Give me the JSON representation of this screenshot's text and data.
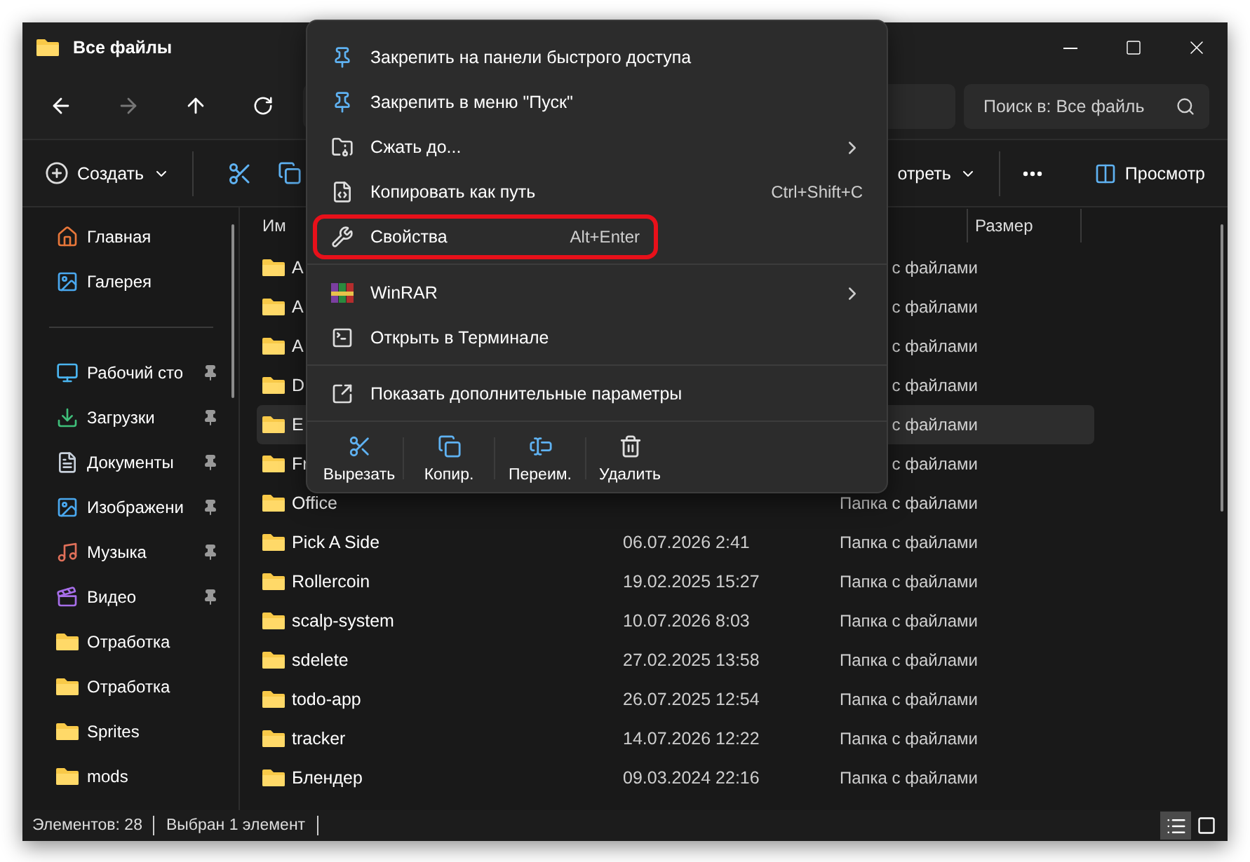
{
  "window": {
    "title": "Все файлы"
  },
  "nav": {
    "search_placeholder": "Поиск в: Все файль"
  },
  "command_bar": {
    "new_label": "Создать",
    "view_label": "отреть",
    "preview_label": "Просмотр"
  },
  "sidebar": {
    "groups": [
      [
        {
          "label": "Главная",
          "pinned": false
        },
        {
          "label": "Галерея",
          "pinned": false
        }
      ],
      [
        {
          "label": "Рабочий сто",
          "pinned": true
        },
        {
          "label": "Загрузки",
          "pinned": true
        },
        {
          "label": "Документы",
          "pinned": true
        },
        {
          "label": "Изображени",
          "pinned": true
        },
        {
          "label": "Музыка",
          "pinned": true
        },
        {
          "label": "Видео",
          "pinned": true
        },
        {
          "label": "Отработка",
          "pinned": false
        },
        {
          "label": "Отработка",
          "pinned": false
        },
        {
          "label": "Sprites",
          "pinned": false
        },
        {
          "label": "mods",
          "pinned": false
        }
      ]
    ]
  },
  "list": {
    "columns": [
      "Им",
      "Размер"
    ],
    "rows": [
      {
        "name": "A",
        "type": "с файлами",
        "selected": false
      },
      {
        "name": "A",
        "type": "с файлами",
        "selected": false
      },
      {
        "name": "A",
        "type": "с файлами",
        "selected": false
      },
      {
        "name": "D",
        "type": "с файлами",
        "selected": false
      },
      {
        "name": "E",
        "type": "с файлами",
        "selected": true
      },
      {
        "name": "Fr",
        "type": "с файлами",
        "selected": false
      },
      {
        "name": "Office",
        "type": "Папка с файлами",
        "selected": false
      },
      {
        "name": "Pick A Side",
        "date": "06.07.2026 2:41",
        "type": "Папка с файлами",
        "selected": false
      },
      {
        "name": "Rollercoin",
        "date": "19.02.2025 15:27",
        "type": "Папка с файлами",
        "selected": false
      },
      {
        "name": "scalp-system",
        "date": "10.07.2026 8:03",
        "type": "Папка с файлами",
        "selected": false
      },
      {
        "name": "sdelete",
        "date": "27.02.2025 13:58",
        "type": "Папка с файлами",
        "selected": false
      },
      {
        "name": "todo-app",
        "date": "26.07.2025 12:54",
        "type": "Папка с файлами",
        "selected": false
      },
      {
        "name": "tracker",
        "date": "14.07.2026 12:22",
        "type": "Папка с файлами",
        "selected": false
      },
      {
        "name": "Блендер",
        "date": "09.03.2024 22:16",
        "type": "Папка с файлами",
        "selected": false
      }
    ]
  },
  "context_menu": {
    "items": [
      {
        "kind": "item",
        "label": "Закрепить на панели быстрого доступа",
        "submenu": false,
        "highlighted": false
      },
      {
        "kind": "item",
        "label": "Закрепить в меню \"Пуск\"",
        "submenu": false,
        "highlighted": false
      },
      {
        "kind": "item",
        "label": "Сжать до...",
        "submenu": true,
        "highlighted": false
      },
      {
        "kind": "item",
        "label": "Копировать как путь",
        "shortcut": "Ctrl+Shift+C",
        "submenu": false,
        "highlighted": false
      },
      {
        "kind": "item",
        "label": "Свойства",
        "shortcut": "Alt+Enter",
        "submenu": false,
        "highlighted": true
      },
      {
        "kind": "separator"
      },
      {
        "kind": "item",
        "label": "WinRAR",
        "submenu": true,
        "highlighted": false
      },
      {
        "kind": "item",
        "label": "Открыть в Терминале",
        "submenu": false,
        "highlighted": false
      },
      {
        "kind": "separator"
      },
      {
        "kind": "item",
        "label": "Показать дополнительные параметры",
        "submenu": false,
        "highlighted": false
      },
      {
        "kind": "separator"
      }
    ],
    "actions": [
      {
        "label": "Вырезать"
      },
      {
        "label": "Копир."
      },
      {
        "label": "Переим."
      },
      {
        "label": "Удалить"
      }
    ]
  },
  "status_bar": {
    "count": "Элементов: 28",
    "selection": "Выбран 1 элемент",
    "views": [
      {
        "selected": true
      },
      {
        "selected": false
      }
    ]
  }
}
